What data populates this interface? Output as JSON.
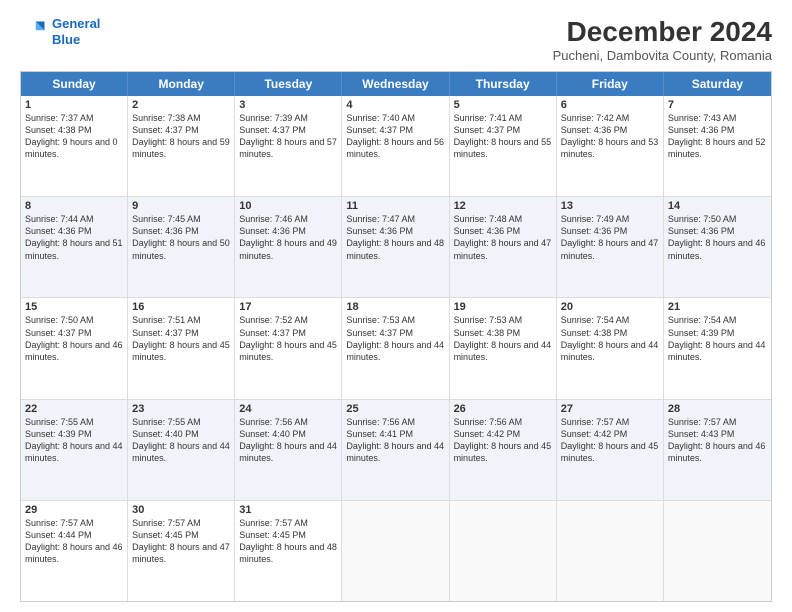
{
  "logo": {
    "line1": "General",
    "line2": "Blue"
  },
  "title": "December 2024",
  "subtitle": "Pucheni, Dambovita County, Romania",
  "header_days": [
    "Sunday",
    "Monday",
    "Tuesday",
    "Wednesday",
    "Thursday",
    "Friday",
    "Saturday"
  ],
  "weeks": [
    {
      "alt": false,
      "cells": [
        {
          "day": "1",
          "sunrise": "Sunrise: 7:37 AM",
          "sunset": "Sunset: 4:38 PM",
          "daylight": "Daylight: 9 hours and 0 minutes."
        },
        {
          "day": "2",
          "sunrise": "Sunrise: 7:38 AM",
          "sunset": "Sunset: 4:37 PM",
          "daylight": "Daylight: 8 hours and 59 minutes."
        },
        {
          "day": "3",
          "sunrise": "Sunrise: 7:39 AM",
          "sunset": "Sunset: 4:37 PM",
          "daylight": "Daylight: 8 hours and 57 minutes."
        },
        {
          "day": "4",
          "sunrise": "Sunrise: 7:40 AM",
          "sunset": "Sunset: 4:37 PM",
          "daylight": "Daylight: 8 hours and 56 minutes."
        },
        {
          "day": "5",
          "sunrise": "Sunrise: 7:41 AM",
          "sunset": "Sunset: 4:37 PM",
          "daylight": "Daylight: 8 hours and 55 minutes."
        },
        {
          "day": "6",
          "sunrise": "Sunrise: 7:42 AM",
          "sunset": "Sunset: 4:36 PM",
          "daylight": "Daylight: 8 hours and 53 minutes."
        },
        {
          "day": "7",
          "sunrise": "Sunrise: 7:43 AM",
          "sunset": "Sunset: 4:36 PM",
          "daylight": "Daylight: 8 hours and 52 minutes."
        }
      ]
    },
    {
      "alt": true,
      "cells": [
        {
          "day": "8",
          "sunrise": "Sunrise: 7:44 AM",
          "sunset": "Sunset: 4:36 PM",
          "daylight": "Daylight: 8 hours and 51 minutes."
        },
        {
          "day": "9",
          "sunrise": "Sunrise: 7:45 AM",
          "sunset": "Sunset: 4:36 PM",
          "daylight": "Daylight: 8 hours and 50 minutes."
        },
        {
          "day": "10",
          "sunrise": "Sunrise: 7:46 AM",
          "sunset": "Sunset: 4:36 PM",
          "daylight": "Daylight: 8 hours and 49 minutes."
        },
        {
          "day": "11",
          "sunrise": "Sunrise: 7:47 AM",
          "sunset": "Sunset: 4:36 PM",
          "daylight": "Daylight: 8 hours and 48 minutes."
        },
        {
          "day": "12",
          "sunrise": "Sunrise: 7:48 AM",
          "sunset": "Sunset: 4:36 PM",
          "daylight": "Daylight: 8 hours and 47 minutes."
        },
        {
          "day": "13",
          "sunrise": "Sunrise: 7:49 AM",
          "sunset": "Sunset: 4:36 PM",
          "daylight": "Daylight: 8 hours and 47 minutes."
        },
        {
          "day": "14",
          "sunrise": "Sunrise: 7:50 AM",
          "sunset": "Sunset: 4:36 PM",
          "daylight": "Daylight: 8 hours and 46 minutes."
        }
      ]
    },
    {
      "alt": false,
      "cells": [
        {
          "day": "15",
          "sunrise": "Sunrise: 7:50 AM",
          "sunset": "Sunset: 4:37 PM",
          "daylight": "Daylight: 8 hours and 46 minutes."
        },
        {
          "day": "16",
          "sunrise": "Sunrise: 7:51 AM",
          "sunset": "Sunset: 4:37 PM",
          "daylight": "Daylight: 8 hours and 45 minutes."
        },
        {
          "day": "17",
          "sunrise": "Sunrise: 7:52 AM",
          "sunset": "Sunset: 4:37 PM",
          "daylight": "Daylight: 8 hours and 45 minutes."
        },
        {
          "day": "18",
          "sunrise": "Sunrise: 7:53 AM",
          "sunset": "Sunset: 4:37 PM",
          "daylight": "Daylight: 8 hours and 44 minutes."
        },
        {
          "day": "19",
          "sunrise": "Sunrise: 7:53 AM",
          "sunset": "Sunset: 4:38 PM",
          "daylight": "Daylight: 8 hours and 44 minutes."
        },
        {
          "day": "20",
          "sunrise": "Sunrise: 7:54 AM",
          "sunset": "Sunset: 4:38 PM",
          "daylight": "Daylight: 8 hours and 44 minutes."
        },
        {
          "day": "21",
          "sunrise": "Sunrise: 7:54 AM",
          "sunset": "Sunset: 4:39 PM",
          "daylight": "Daylight: 8 hours and 44 minutes."
        }
      ]
    },
    {
      "alt": true,
      "cells": [
        {
          "day": "22",
          "sunrise": "Sunrise: 7:55 AM",
          "sunset": "Sunset: 4:39 PM",
          "daylight": "Daylight: 8 hours and 44 minutes."
        },
        {
          "day": "23",
          "sunrise": "Sunrise: 7:55 AM",
          "sunset": "Sunset: 4:40 PM",
          "daylight": "Daylight: 8 hours and 44 minutes."
        },
        {
          "day": "24",
          "sunrise": "Sunrise: 7:56 AM",
          "sunset": "Sunset: 4:40 PM",
          "daylight": "Daylight: 8 hours and 44 minutes."
        },
        {
          "day": "25",
          "sunrise": "Sunrise: 7:56 AM",
          "sunset": "Sunset: 4:41 PM",
          "daylight": "Daylight: 8 hours and 44 minutes."
        },
        {
          "day": "26",
          "sunrise": "Sunrise: 7:56 AM",
          "sunset": "Sunset: 4:42 PM",
          "daylight": "Daylight: 8 hours and 45 minutes."
        },
        {
          "day": "27",
          "sunrise": "Sunrise: 7:57 AM",
          "sunset": "Sunset: 4:42 PM",
          "daylight": "Daylight: 8 hours and 45 minutes."
        },
        {
          "day": "28",
          "sunrise": "Sunrise: 7:57 AM",
          "sunset": "Sunset: 4:43 PM",
          "daylight": "Daylight: 8 hours and 46 minutes."
        }
      ]
    },
    {
      "alt": false,
      "cells": [
        {
          "day": "29",
          "sunrise": "Sunrise: 7:57 AM",
          "sunset": "Sunset: 4:44 PM",
          "daylight": "Daylight: 8 hours and 46 minutes."
        },
        {
          "day": "30",
          "sunrise": "Sunrise: 7:57 AM",
          "sunset": "Sunset: 4:45 PM",
          "daylight": "Daylight: 8 hours and 47 minutes."
        },
        {
          "day": "31",
          "sunrise": "Sunrise: 7:57 AM",
          "sunset": "Sunset: 4:45 PM",
          "daylight": "Daylight: 8 hours and 48 minutes."
        },
        {
          "day": "",
          "sunrise": "",
          "sunset": "",
          "daylight": ""
        },
        {
          "day": "",
          "sunrise": "",
          "sunset": "",
          "daylight": ""
        },
        {
          "day": "",
          "sunrise": "",
          "sunset": "",
          "daylight": ""
        },
        {
          "day": "",
          "sunrise": "",
          "sunset": "",
          "daylight": ""
        }
      ]
    }
  ]
}
